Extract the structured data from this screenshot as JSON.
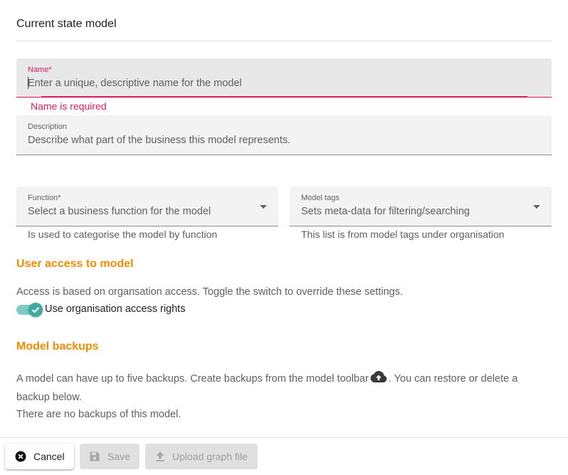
{
  "dialog": {
    "title": "Current state model"
  },
  "name_field": {
    "label": "Name*",
    "placeholder": "Enter a unique, descriptive name for the model",
    "error": "Name is required"
  },
  "description_field": {
    "label": "Description",
    "placeholder": "Describe what part of the business this model represents."
  },
  "function_field": {
    "label": "Function*",
    "placeholder": "Select a business function for the model",
    "hint": "Is used to categorise the model by function"
  },
  "tags_field": {
    "label": "Model tags",
    "placeholder": "Sets meta-data for filtering/searching",
    "hint": "This list is from model tags under organisation"
  },
  "user_access": {
    "heading": "User access to model",
    "description": "Access is based on organsation access. Toggle the switch to override these settings.",
    "toggle_label": "Use organisation access rights",
    "toggle_on": true
  },
  "backups": {
    "heading": "Model backups",
    "text_before_icon": "A model can have up to five backups. Create backups from the model toolbar",
    "text_after_icon": ". You can restore or delete a",
    "text_line2": "backup below.",
    "empty_text": "There are no backups of this model."
  },
  "footer": {
    "cancel_label": "Cancel",
    "save_label": "Save",
    "upload_label": "Upload graph file"
  },
  "colors": {
    "accent_orange": "#f28b00",
    "error_pink": "#d81b60",
    "toggle_teal": "#3fa9a1"
  }
}
